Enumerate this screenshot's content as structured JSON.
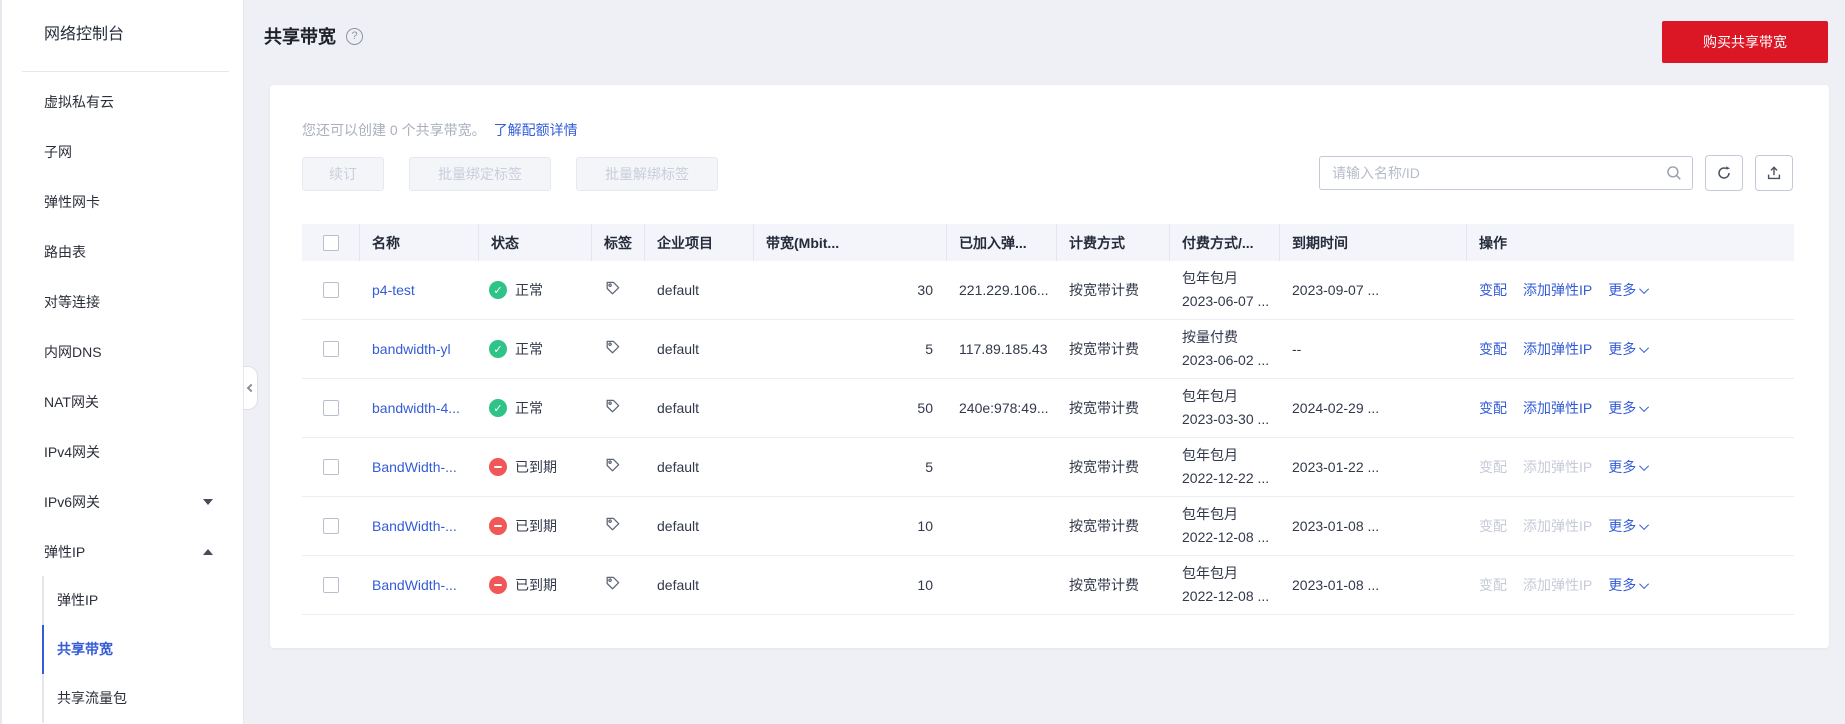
{
  "colors": {
    "accent_red": "#db1625",
    "link_blue": "#345cd8",
    "status_normal_green": "#2fc487",
    "status_expired_red": "#f25757",
    "table_header_bg": "#f3f5fa"
  },
  "sidebar": {
    "title": "网络控制台",
    "items": [
      {
        "key": "vpc",
        "label": "虚拟私有云",
        "arrow": null
      },
      {
        "key": "subnet",
        "label": "子网",
        "arrow": null
      },
      {
        "key": "eni",
        "label": "弹性网卡",
        "arrow": null
      },
      {
        "key": "route-table",
        "label": "路由表",
        "arrow": null
      },
      {
        "key": "peering",
        "label": "对等连接",
        "arrow": null
      },
      {
        "key": "private-dns",
        "label": "内网DNS",
        "arrow": null
      },
      {
        "key": "nat-gateway",
        "label": "NAT网关",
        "arrow": null
      },
      {
        "key": "ipv4-gateway",
        "label": "IPv4网关",
        "arrow": null
      },
      {
        "key": "ipv6-gateway",
        "label": "IPv6网关",
        "arrow": "down"
      },
      {
        "key": "eip",
        "label": "弹性IP",
        "arrow": "up"
      }
    ],
    "subitems": [
      {
        "key": "eip",
        "label": "弹性IP",
        "active": false
      },
      {
        "key": "shared-bandwidth",
        "label": "共享带宽",
        "active": true
      },
      {
        "key": "shared-data-package",
        "label": "共享流量包",
        "active": false
      }
    ]
  },
  "header": {
    "title": "共享带宽",
    "buy_button": "购买共享带宽"
  },
  "toolbar": {
    "quota_text": "您还可以创建 0 个共享带宽。",
    "quota_link": "了解配额详情",
    "renew_button": "续订",
    "batch_bind_button": "批量绑定标签",
    "batch_unbind_button": "批量解绑标签",
    "search_placeholder": "请输入名称/ID"
  },
  "table": {
    "columns": [
      "名称",
      "状态",
      "标签",
      "企业项目",
      "带宽(Mbit...",
      "已加入弹...",
      "计费方式",
      "付费方式/...",
      "到期时间",
      "操作"
    ],
    "ops": {
      "resize": "变配",
      "add_eip": "添加弹性IP",
      "more": "更多"
    },
    "rows": [
      {
        "name": "p4-test",
        "status": "正常",
        "status_type": "normal",
        "project": "default",
        "bandwidth": "30",
        "eip": "221.229.106...",
        "billing": "按宽带计费",
        "pay_mode": "包年包月",
        "pay_date": "2023-06-07 ...",
        "expire": "2023-09-07 ...",
        "ops_enabled": true
      },
      {
        "name": "bandwidth-yl",
        "status": "正常",
        "status_type": "normal",
        "project": "default",
        "bandwidth": "5",
        "eip": "117.89.185.43",
        "billing": "按宽带计费",
        "pay_mode": "按量付费",
        "pay_date": "2023-06-02 ...",
        "expire": "--",
        "ops_enabled": true
      },
      {
        "name": "bandwidth-4...",
        "status": "正常",
        "status_type": "normal",
        "project": "default",
        "bandwidth": "50",
        "eip": "240e:978:49...",
        "billing": "按宽带计费",
        "pay_mode": "包年包月",
        "pay_date": "2023-03-30 ...",
        "expire": "2024-02-29 ...",
        "ops_enabled": true
      },
      {
        "name": "BandWidth-...",
        "status": "已到期",
        "status_type": "expired",
        "project": "default",
        "bandwidth": "5",
        "eip": "",
        "billing": "按宽带计费",
        "pay_mode": "包年包月",
        "pay_date": "2022-12-22 ...",
        "expire": "2023-01-22 ...",
        "ops_enabled": false
      },
      {
        "name": "BandWidth-...",
        "status": "已到期",
        "status_type": "expired",
        "project": "default",
        "bandwidth": "10",
        "eip": "",
        "billing": "按宽带计费",
        "pay_mode": "包年包月",
        "pay_date": "2022-12-08 ...",
        "expire": "2023-01-08 ...",
        "ops_enabled": false
      },
      {
        "name": "BandWidth-...",
        "status": "已到期",
        "status_type": "expired",
        "project": "default",
        "bandwidth": "10",
        "eip": "",
        "billing": "按宽带计费",
        "pay_mode": "包年包月",
        "pay_date": "2022-12-08 ...",
        "expire": "2023-01-08 ...",
        "ops_enabled": false
      }
    ]
  }
}
